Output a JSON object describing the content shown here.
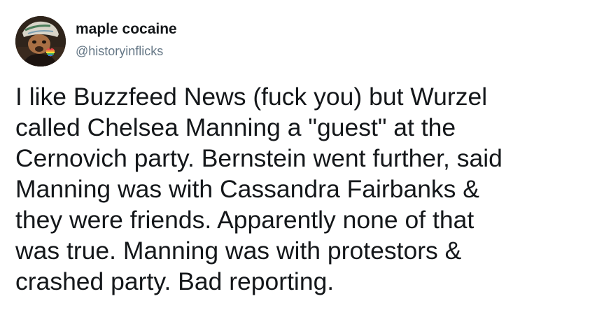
{
  "author": {
    "display_name": "maple cocaine",
    "handle": "@historyinflicks",
    "avatar_icon": "profile-photo-icon"
  },
  "tweet": {
    "lines": [
      "I like Buzzfeed News (fuck you) but Wurzel",
      "called Chelsea Manning a \"guest\" at the",
      "Cernovich party. Bernstein went further, said",
      "Manning was with Cassandra Fairbanks &",
      "they were friends. Apparently none of that",
      "was true. Manning was with protestors &",
      "crashed party. Bad reporting."
    ]
  },
  "colors": {
    "text": "#14171a",
    "secondary_text": "#657786",
    "background": "#ffffff"
  }
}
